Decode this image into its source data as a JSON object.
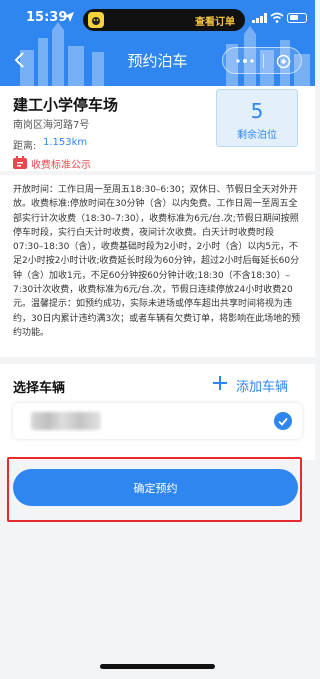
{
  "status_bar": {
    "time": "15:39",
    "pill_text": "查看订单"
  },
  "nav": {
    "title": "预约泊车"
  },
  "lot": {
    "name": "建工小学停车场",
    "address": "南岗区海河路7号",
    "distance_label": "距离:",
    "distance_value": "1.153km",
    "fee_link": "收费标准公示",
    "spots_count": "5",
    "spots_label": "剩余泊位"
  },
  "rules": {
    "text": "开放时间：工作日周一至周五18:30–6:30；双休日、节假日全天对外开放。收费标准:停放时间在30分钟（含）以内免费。工作日周一至周五全部实行计次收费（18:30–7:30），收费标准为6元/台.次;节假日期间按照停车时段，实行白天计时收费，夜间计次收费。白天计时收费时段07:30–18:30（含），收费基础时段为2小时，2小时（含）以内5元，不足2小时按2小时计收;收费延长时段为60分钟，超过2小时后每延长60分钟（含）加收1元，不足60分钟按60分钟计收;18:30（不含18:30）–7:30计次收费，收费标准为6元/台.次，节假日连续停放24小时收费20元。温馨提示：如预约成功，实际未进场或停车超出共享时间将视为违约，30日内累计违约满3次；或者车辆有欠费订单，将影响在此场地的预约功能。"
  },
  "vehicle": {
    "section_title": "选择车辆",
    "add_label": "添加车辆"
  },
  "confirm": {
    "label": "确定预约"
  },
  "colors": {
    "primary": "#2f86f0",
    "fee_red": "#e8474c",
    "highlight_frame": "#e52b2b"
  }
}
